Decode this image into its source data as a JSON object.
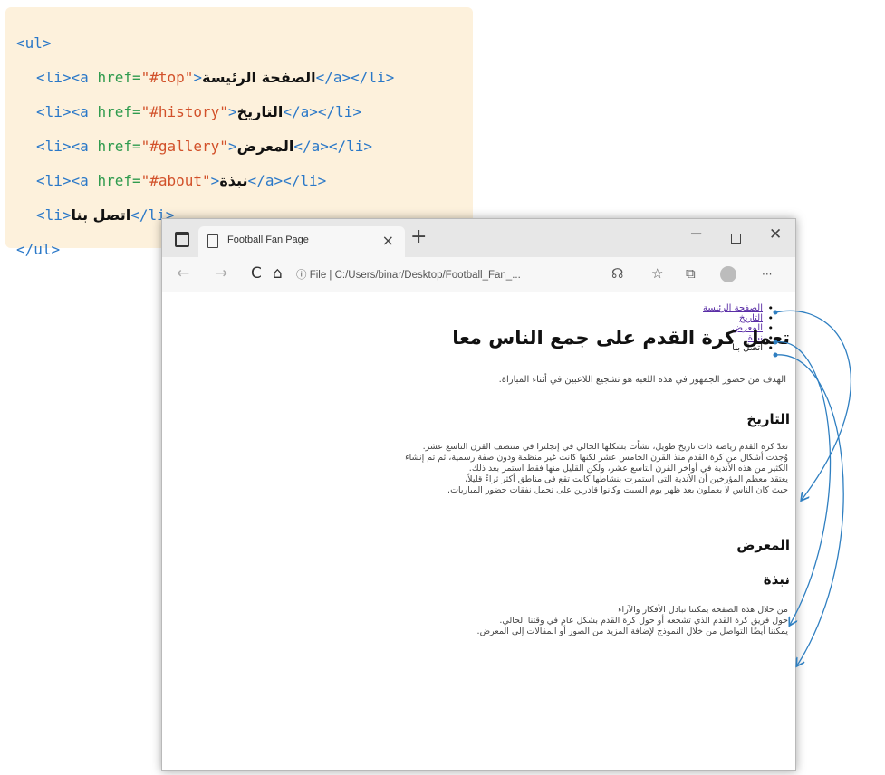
{
  "code": {
    "open_ul": "<ul>",
    "close_ul": "</ul>",
    "lines": [
      {
        "pre": "<li><a ",
        "attr": "href=",
        "val": "\"#top\"",
        "gt": ">",
        "text": "الصفحة الرئيسة",
        "post": "</a></li>"
      },
      {
        "pre": "<li><a ",
        "attr": "href=",
        "val": "\"#history\"",
        "gt": ">",
        "text": "التاريخ",
        "post": "</a></li>"
      },
      {
        "pre": "<li><a ",
        "attr": "href=",
        "val": "\"#gallery\"",
        "gt": ">",
        "text": "المعرض",
        "post": "</a></li>"
      },
      {
        "pre": "<li><a ",
        "attr": "href=",
        "val": "\"#about\"",
        "gt": ">",
        "text": "نبذة",
        "post": "</a></li>"
      },
      {
        "pre": "<li>",
        "text": "اتصل بنا",
        "post": "</li>"
      }
    ]
  },
  "browser": {
    "tab_title": "Football Fan Page",
    "tab_close": "×",
    "new_tab": "+",
    "minimize": "−",
    "close": "✕",
    "back": "←",
    "forward": "→",
    "reload": "C",
    "home": "⌂",
    "url_info": "ⓘ File  |  ",
    "url": "C:/Users/binar/Desktop/Football_Fan_...",
    "menu": "···"
  },
  "page": {
    "nav_links": [
      "الصفحة الرئيسة",
      "التاريخ",
      "المعرض",
      "نبذة"
    ],
    "nav_plain": "اتصل بنا",
    "title": "تعمل كرة القدم على جمع الناس معا",
    "intro": "الهدف من حضور الجمهور في هذه اللعبة هو تشجيع اللاعبين في أثناء المباراة.",
    "history_heading": "التاريخ",
    "history_lines": [
      "تعدّ كرة القدم رياضة ذات تاريخ طويل، نشأت بشكلها الحالي في إنجلترا في منتصف القرن التاسع عشر.",
      "وُجدت أشكال من كرة القدم منذ القرن الخامس عشر لكنها كانت غير منظمة ودون صفة رسمية، ثم تم إنشاء",
      "الكثير من هذه الأندية في أواخر القرن التاسع عشر، ولكن القليل منها فقط استمر بعد ذلك.",
      "يعتقد معظم المؤرخين أن الأندية التي استمرت بنشاطها كانت تقع في مناطق أكثر ثراءً قليلاً،",
      "حيث كان الناس لا يعملون بعد ظهر يوم السبت وكانوا قادرين على تحمل نفقات حضور المباريات."
    ],
    "gallery_heading": "المعرض",
    "about_heading": "نبذة",
    "about_lines": [
      "من خلال هذه الصفحة يمكننا تبادل الأفكار والآراء",
      "حول فريق كرة القدم الذي تشجعه أو حول كرة القدم بشكل عام في وقتنا الحالي.",
      "يمكننا أيضًا التواصل من خلال النموذج لإضافة المزيد من الصور أو المقالات إلى المعرض."
    ]
  },
  "colors": {
    "code_bg": "#fdf1dc",
    "code_tag": "#2a78c8",
    "code_attr": "#2f9b4e",
    "code_value": "#d2512a",
    "link": "#5a2ea6",
    "arrow": "#2f7fc1"
  }
}
